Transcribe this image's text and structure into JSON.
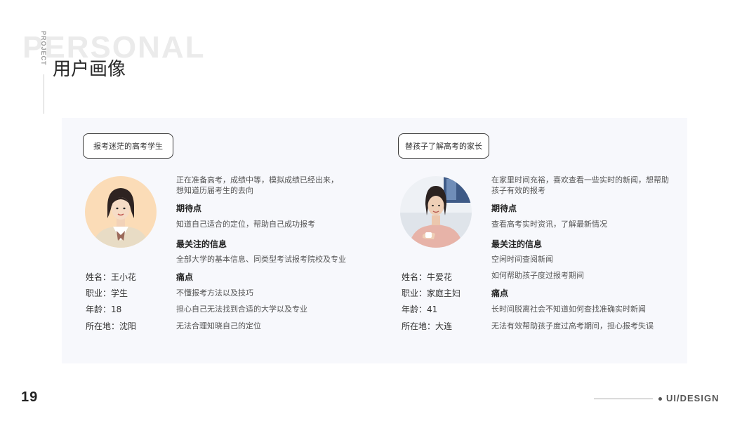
{
  "header": {
    "bg_word": "PERSONAL",
    "vertical_label": "PROJECT",
    "title": "用户画像"
  },
  "personas": [
    {
      "tag": "报考迷茫的高考学生",
      "name_row": "姓名：王小花",
      "job_row": "职业：学生",
      "age_row": "年龄：18",
      "location_row": "所在地：沈阳",
      "intro_line1": "正在准备高考，成绩中等，模拟成绩已经出来，",
      "intro_line2": "想知道历届考生的去向",
      "expect_heading": "期待点",
      "expect_text": "知道自己适合的定位，帮助自己成功报考",
      "focus_heading": "最关注的信息",
      "focus_text": "全部大学的基本信息、同类型考试报考院校及专业",
      "pain_heading": "痛点",
      "pain_1": "不懂报考方法以及技巧",
      "pain_2": "担心自己无法找到合适的大学以及专业",
      "pain_3": "无法合理知晓自己的定位"
    },
    {
      "tag": "替孩子了解高考的家长",
      "name_row": "姓名：牛爱花",
      "job_row": "职业：家庭主妇",
      "age_row": "年龄：41",
      "location_row": "所在地：大连",
      "intro_line1": "在家里时间充裕，喜欢查看一些实时的新闻，想帮助",
      "intro_line2": "孩子有效的报考",
      "expect_heading": "期待点",
      "expect_text": "查看高考实时资讯，了解最新情况",
      "focus_heading": "最关注的信息",
      "focus_text_1": "空闲时间查阅新闻",
      "focus_text_2": "如何帮助孩子度过报考期间",
      "pain_heading": "痛点",
      "pain_1": "长时间脱离社会不知道如何查找准确实时新闻",
      "pain_2": "无法有效帮助孩子度过高考期间，担心报考失误"
    }
  ],
  "footer": {
    "page_number": "19",
    "label": "UI/DESIGN"
  },
  "colors": {
    "panel_bg": "#f7f8fc",
    "bg_word": "#ebebeb",
    "text_dark": "#222222",
    "text_body": "#555555"
  },
  "icons": {
    "persona_1_avatar": "student-portrait",
    "persona_2_avatar": "parent-portrait"
  }
}
